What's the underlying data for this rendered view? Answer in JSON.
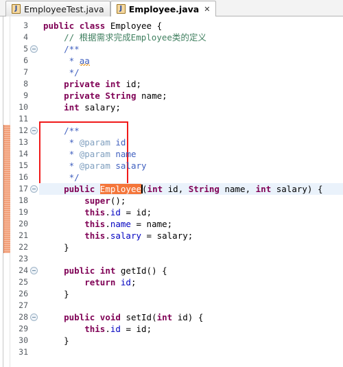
{
  "window": {
    "app": "Eclipse IDE",
    "file_icon": "java-file-icon"
  },
  "tabs": [
    {
      "label": "EmployeeTest.java",
      "active": false,
      "icon": "java-file-icon",
      "close": ""
    },
    {
      "label": "Employee.java",
      "active": true,
      "icon": "java-file-icon",
      "close": "✕"
    }
  ],
  "editor": {
    "first_line": 3,
    "last_line": 31,
    "current_line": 17,
    "selected_text": "Employee",
    "folding_lines": [
      5,
      12,
      17,
      24,
      28
    ],
    "change_bar_from_line": 12,
    "change_bar_to_line": 22,
    "annotation_box": {
      "color": "#f01818",
      "from_line": 12,
      "to_line": 16
    },
    "colors": {
      "keyword": "#7f0055",
      "comment": "#3f7f5f",
      "javadoc": "#3f5fbf",
      "javadoc_tag": "#7f9fbf",
      "field": "#0000c0",
      "selection": "#f4763b",
      "current_line": "#eaf2fb",
      "change_bar": "#f2a07a",
      "spell_warning": "#e8a33d"
    },
    "lines": [
      {
        "n": 3,
        "text": "public class Employee {"
      },
      {
        "n": 4,
        "text": "    // 根据需求完成Employee类的定义"
      },
      {
        "n": 5,
        "text": "    /**"
      },
      {
        "n": 6,
        "text": "     * aa"
      },
      {
        "n": 7,
        "text": "     */"
      },
      {
        "n": 8,
        "text": "    private int id;"
      },
      {
        "n": 9,
        "text": "    private String name;"
      },
      {
        "n": 10,
        "text": "    int salary;"
      },
      {
        "n": 11,
        "text": ""
      },
      {
        "n": 12,
        "text": "    /**"
      },
      {
        "n": 13,
        "text": "     * @param id"
      },
      {
        "n": 14,
        "text": "     * @param name"
      },
      {
        "n": 15,
        "text": "     * @param salary"
      },
      {
        "n": 16,
        "text": "     */"
      },
      {
        "n": 17,
        "text": "    public Employee(int id, String name, int salary) {"
      },
      {
        "n": 18,
        "text": "        super();"
      },
      {
        "n": 19,
        "text": "        this.id = id;"
      },
      {
        "n": 20,
        "text": "        this.name = name;"
      },
      {
        "n": 21,
        "text": "        this.salary = salary;"
      },
      {
        "n": 22,
        "text": "    }"
      },
      {
        "n": 23,
        "text": ""
      },
      {
        "n": 24,
        "text": "    public int getId() {"
      },
      {
        "n": 25,
        "text": "        return id;"
      },
      {
        "n": 26,
        "text": "    }"
      },
      {
        "n": 27,
        "text": ""
      },
      {
        "n": 28,
        "text": "    public void setId(int id) {"
      },
      {
        "n": 29,
        "text": "        this.id = id;"
      },
      {
        "n": 30,
        "text": "    }"
      },
      {
        "n": 31,
        "text": ""
      }
    ]
  }
}
